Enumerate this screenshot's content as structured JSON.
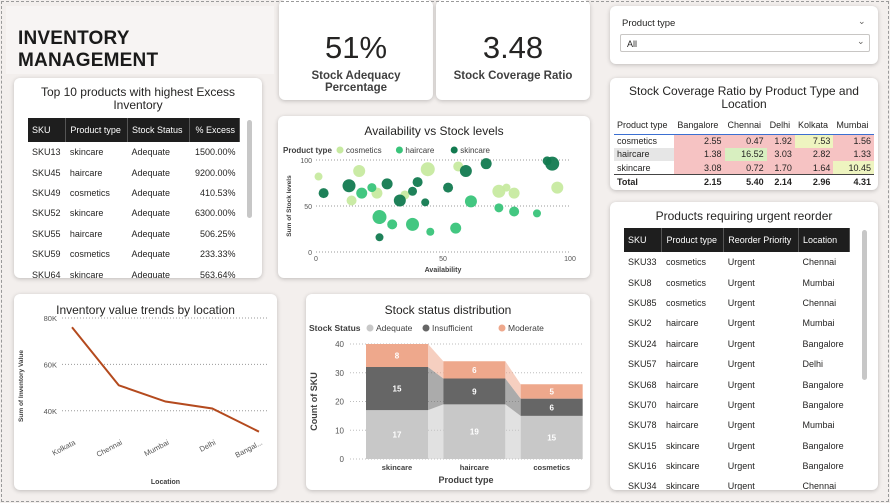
{
  "page_title": "INVENTORY MANAGEMENT",
  "kpis": [
    {
      "value": "51%",
      "label": "Stock Adequacy Percentage"
    },
    {
      "value": "3.48",
      "label": "Stock Coverage Ratio"
    }
  ],
  "slicer": {
    "label": "Product type",
    "value": "All"
  },
  "top_excess": {
    "title": "Top 10 products with highest Excess Inventory",
    "columns": [
      "SKU",
      "Product type",
      "Stock Status",
      "% Excess"
    ],
    "rows": [
      [
        "SKU13",
        "skincare",
        "Adequate",
        "1500.00%"
      ],
      [
        "SKU45",
        "haircare",
        "Adequate",
        "9200.00%"
      ],
      [
        "SKU49",
        "cosmetics",
        "Adequate",
        "410.53%"
      ],
      [
        "SKU52",
        "skincare",
        "Adequate",
        "6300.00%"
      ],
      [
        "SKU55",
        "haircare",
        "Adequate",
        "506.25%"
      ],
      [
        "SKU59",
        "cosmetics",
        "Adequate",
        "233.33%"
      ],
      [
        "SKU64",
        "skincare",
        "Adequate",
        "563.64%"
      ]
    ]
  },
  "coverage_matrix": {
    "title": "Stock Coverage Ratio by Product Type and Location",
    "columns": [
      "Product type",
      "Bangalore",
      "Chennai",
      "Delhi",
      "Kolkata",
      "Mumbai"
    ],
    "rows": [
      {
        "label": "cosmetics",
        "values": [
          "2.55",
          "0.47",
          "1.92",
          "7.53",
          "1.56"
        ]
      },
      {
        "label": "haircare",
        "values": [
          "1.38",
          "16.52",
          "3.03",
          "2.82",
          "1.33"
        ]
      },
      {
        "label": "skincare",
        "values": [
          "3.08",
          "0.72",
          "1.70",
          "1.64",
          "10.45"
        ]
      }
    ],
    "total": {
      "label": "Total",
      "values": [
        "2.15",
        "5.40",
        "2.14",
        "2.96",
        "4.31"
      ]
    },
    "cell_colors": [
      [
        "#f6c3c3",
        "#f6c3c3",
        "#f6c3c3",
        "#eef4c0",
        "#f6c3c3"
      ],
      [
        "#f6c3c3",
        "#d8efc0",
        "#f6c3c3",
        "#f6c3c3",
        "#f6c3c3"
      ],
      [
        "#f6c3c3",
        "#f6c3c3",
        "#f6c3c3",
        "#f6c3c3",
        "#eef4c0"
      ]
    ]
  },
  "reorder": {
    "title": "Products requiring urgent reorder",
    "columns": [
      "SKU",
      "Product type",
      "Reorder Priority",
      "Location"
    ],
    "rows": [
      [
        "SKU33",
        "cosmetics",
        "Urgent",
        "Chennai"
      ],
      [
        "SKU8",
        "cosmetics",
        "Urgent",
        "Mumbai"
      ],
      [
        "SKU85",
        "cosmetics",
        "Urgent",
        "Chennai"
      ],
      [
        "SKU2",
        "haircare",
        "Urgent",
        "Mumbai"
      ],
      [
        "SKU24",
        "haircare",
        "Urgent",
        "Bangalore"
      ],
      [
        "SKU57",
        "haircare",
        "Urgent",
        "Delhi"
      ],
      [
        "SKU68",
        "haircare",
        "Urgent",
        "Bangalore"
      ],
      [
        "SKU70",
        "haircare",
        "Urgent",
        "Bangalore"
      ],
      [
        "SKU78",
        "haircare",
        "Urgent",
        "Mumbai"
      ],
      [
        "SKU15",
        "skincare",
        "Urgent",
        "Bangalore"
      ],
      [
        "SKU16",
        "skincare",
        "Urgent",
        "Bangalore"
      ],
      [
        "SKU34",
        "skincare",
        "Urgent",
        "Chennai"
      ]
    ]
  },
  "chart_data": [
    {
      "type": "scatter",
      "title": "Availability vs Stock levels",
      "xlabel": "Availability",
      "ylabel": "Sum of Stock levels",
      "legend_title": "Product type",
      "xlim": [
        0,
        100
      ],
      "ylim": [
        0,
        100
      ],
      "xticks": [
        "0",
        "50",
        "100"
      ],
      "yticks": [
        "0",
        "50",
        "100"
      ],
      "series": [
        {
          "name": "cosmetics",
          "color": "#c7eaa0",
          "points": [
            [
              1,
              82
            ],
            [
              14,
              56
            ],
            [
              17,
              88
            ],
            [
              24,
              64
            ],
            [
              35,
              62
            ],
            [
              44,
              90
            ],
            [
              56,
              93
            ],
            [
              72,
              66
            ],
            [
              75,
              70
            ],
            [
              78,
              64
            ],
            [
              95,
              70
            ]
          ]
        },
        {
          "name": "haircare",
          "color": "#39c47a",
          "points": [
            [
              18,
              64
            ],
            [
              22,
              70
            ],
            [
              25,
              38
            ],
            [
              30,
              30
            ],
            [
              38,
              30
            ],
            [
              45,
              22
            ],
            [
              55,
              26
            ],
            [
              61,
              55
            ],
            [
              72,
              48
            ],
            [
              78,
              44
            ],
            [
              87,
              42
            ]
          ]
        },
        {
          "name": "skincare",
          "color": "#127a50",
          "points": [
            [
              3,
              64
            ],
            [
              13,
              72
            ],
            [
              25,
              16
            ],
            [
              28,
              74
            ],
            [
              33,
              56
            ],
            [
              38,
              66
            ],
            [
              40,
              76
            ],
            [
              43,
              54
            ],
            [
              52,
              70
            ],
            [
              59,
              88
            ],
            [
              67,
              96
            ],
            [
              91,
              99
            ],
            [
              93,
              96
            ]
          ]
        }
      ]
    },
    {
      "type": "line",
      "title": "Inventory value trends by location",
      "xlabel": "Location",
      "ylabel": "Sum of Inventory Value",
      "categories": [
        "Kolkata",
        "Chennai",
        "Mumbai",
        "Delhi",
        "Bangal..."
      ],
      "ylim": [
        30000,
        80000
      ],
      "yticks": [
        "40K",
        "60K",
        "80K"
      ],
      "series": [
        {
          "name": "Sum of Inventory Value",
          "color": "#b44a1e",
          "values": [
            76000,
            51000,
            44000,
            41000,
            31000
          ]
        }
      ]
    },
    {
      "type": "bar",
      "title": "Stock status distribution",
      "xlabel": "Product type",
      "ylabel": "Count of SKU",
      "legend_title": "Stock Status",
      "categories": [
        "skincare",
        "haircare",
        "cosmetics"
      ],
      "ylim": [
        0,
        40
      ],
      "yticks": [
        "0",
        "10",
        "20",
        "30",
        "40"
      ],
      "series": [
        {
          "name": "Adequate",
          "color": "#c8c8c8",
          "values": [
            17,
            19,
            15
          ]
        },
        {
          "name": "Insufficient",
          "color": "#666666",
          "values": [
            15,
            9,
            6
          ]
        },
        {
          "name": "Moderate",
          "color": "#eea88c",
          "values": [
            8,
            6,
            5
          ]
        }
      ]
    }
  ]
}
